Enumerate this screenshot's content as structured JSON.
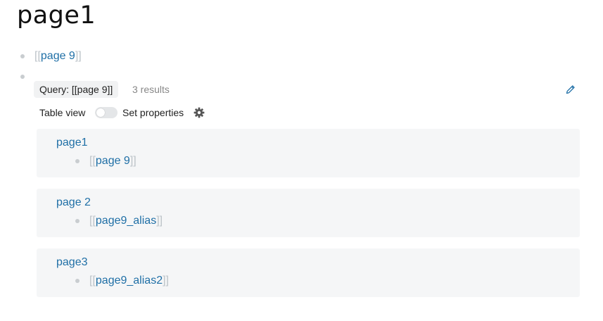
{
  "page": {
    "title": "page1"
  },
  "blocks": [
    {
      "bracket_open": "[[",
      "ref": "page 9",
      "bracket_close": "]]"
    }
  ],
  "query": {
    "label": "Query: [[page 9]]",
    "results_count": "3 results",
    "table_view_label": "Table view",
    "table_view_on": false,
    "set_properties_label": "Set properties"
  },
  "results": [
    {
      "title": "page1",
      "bracket_open": "[[",
      "ref": "page 9",
      "bracket_close": "]]"
    },
    {
      "title": "page 2",
      "bracket_open": "[[",
      "ref": "page9_alias",
      "bracket_close": "]]"
    },
    {
      "title": "page3",
      "bracket_open": "[[",
      "ref": "page9_alias2",
      "bracket_close": "]]"
    }
  ],
  "icons": {
    "edit": "pencil-icon",
    "settings": "gear-icon"
  },
  "colors": {
    "link": "#1f6fa6",
    "bracket": "#bcc3c8",
    "bullet": "#c9cdd0",
    "card_bg": "#f5f6f7"
  }
}
